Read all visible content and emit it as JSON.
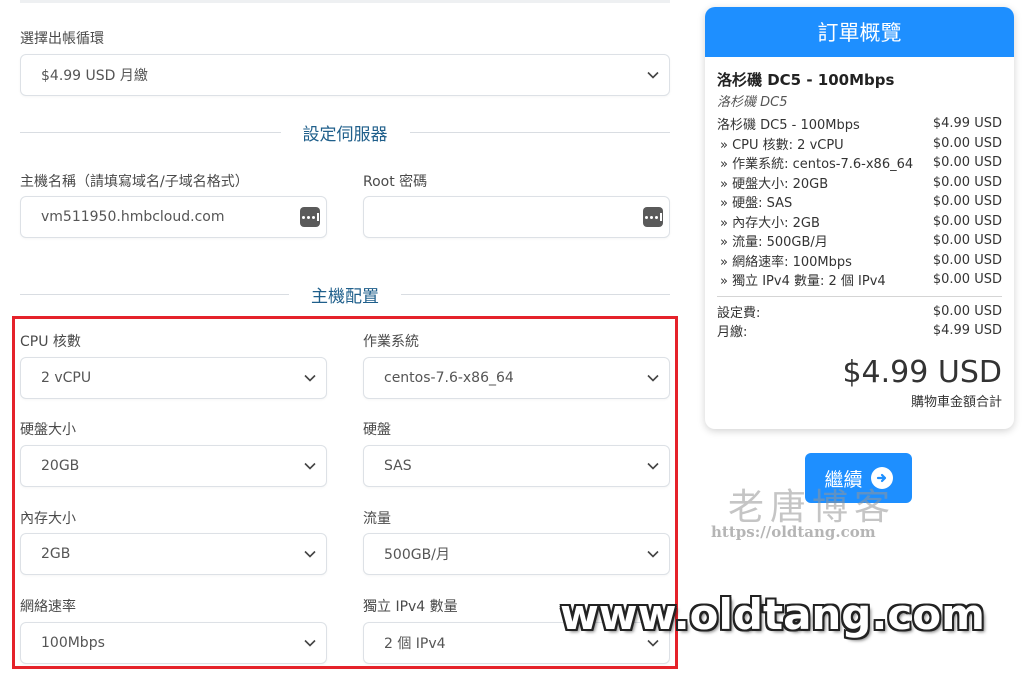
{
  "billing": {
    "label": "選擇出帳循環",
    "value": "$4.99 USD 月繳"
  },
  "server_section": {
    "title": "設定伺服器",
    "hostname_label": "主機名稱（請填寫域名/子域名格式）",
    "hostname_value": "vm511950.hmbcloud.com",
    "root_label": "Root 密碼",
    "root_value": ""
  },
  "config_section": {
    "title": "主機配置",
    "options": [
      {
        "label": "CPU 核數",
        "value": "2 vCPU"
      },
      {
        "label": "作業系統",
        "value": "centos-7.6-x86_64"
      },
      {
        "label": "硬盤大小",
        "value": "20GB"
      },
      {
        "label": "硬盤",
        "value": "SAS"
      },
      {
        "label": "內存大小",
        "value": "2GB"
      },
      {
        "label": "流量",
        "value": "500GB/月"
      },
      {
        "label": "網絡速率",
        "value": "100Mbps"
      },
      {
        "label": "獨立 IPv4 數量",
        "value": "2 個 IPv4"
      }
    ]
  },
  "summary": {
    "title": "訂單概覽",
    "product_name": "洛杉磯 DC5 - 100Mbps",
    "product_group": "洛杉磯 DC5",
    "items": [
      {
        "desc": "洛杉磯 DC5 - 100Mbps",
        "price": "$4.99 USD"
      },
      {
        "desc": "» CPU 核數: 2 vCPU",
        "price": "$0.00 USD"
      },
      {
        "desc": "» 作業系統: centos-7.6-x86_64",
        "price": "$0.00 USD"
      },
      {
        "desc": "» 硬盤大小: 20GB",
        "price": "$0.00 USD"
      },
      {
        "desc": "» 硬盤: SAS",
        "price": "$0.00 USD"
      },
      {
        "desc": "» 內存大小: 2GB",
        "price": "$0.00 USD"
      },
      {
        "desc": "» 流量: 500GB/月",
        "price": "$0.00 USD"
      },
      {
        "desc": "» 網絡速率: 100Mbps",
        "price": "$0.00 USD"
      },
      {
        "desc": "» 獨立 IPv4 數量: 2 個 IPv4",
        "price": "$0.00 USD"
      }
    ],
    "setup_label": "設定費:",
    "setup_price": "$0.00 USD",
    "monthly_label": "月繳:",
    "monthly_price": "$4.99 USD",
    "total": "$4.99 USD",
    "total_label": "購物車金額合計"
  },
  "continue_label": "繼續",
  "watermark": {
    "cn": "老唐博客",
    "url_small": "https://oldtang.com",
    "url_big": "www.oldtang.com"
  },
  "colors": {
    "accent": "#1e8fff",
    "section_title": "#1f5f8b",
    "highlight_box": "#e5222a"
  }
}
